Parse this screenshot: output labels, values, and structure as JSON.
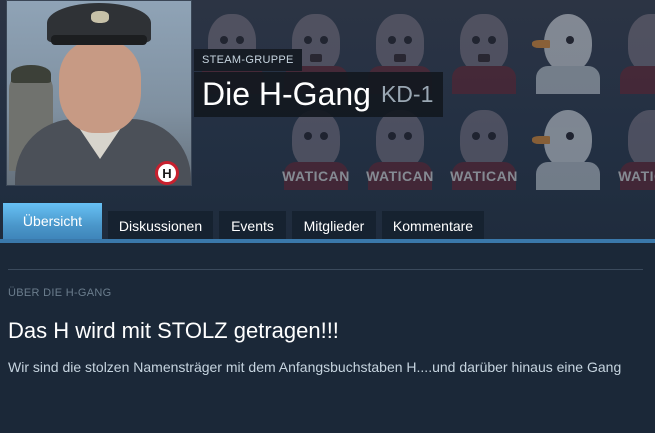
{
  "header": {
    "group_tag": "STEAM-GRUPPE",
    "group_name": "Die H-Gang",
    "group_abbr": "KD-1",
    "background_watermark": "WATICAN",
    "avatar_badge": "H"
  },
  "tabs": [
    {
      "label": "Übersicht",
      "active": true
    },
    {
      "label": "Diskussionen",
      "active": false
    },
    {
      "label": "Events",
      "active": false
    },
    {
      "label": "Mitglieder",
      "active": false
    },
    {
      "label": "Kommentare",
      "active": false
    }
  ],
  "about": {
    "section_label": "ÜBER DIE H-GANG",
    "headline": "Das H wird mit STOLZ getragen!!!",
    "description": "Wir sind die stolzen Namensträger mit dem Anfangsbuchstaben H....und darüber hinaus eine Gang"
  },
  "colors": {
    "page_background": "#1b2838",
    "tab_active": "#67c1f5",
    "tab_inactive": "#162230",
    "accent_rule": "#3a78aa"
  }
}
